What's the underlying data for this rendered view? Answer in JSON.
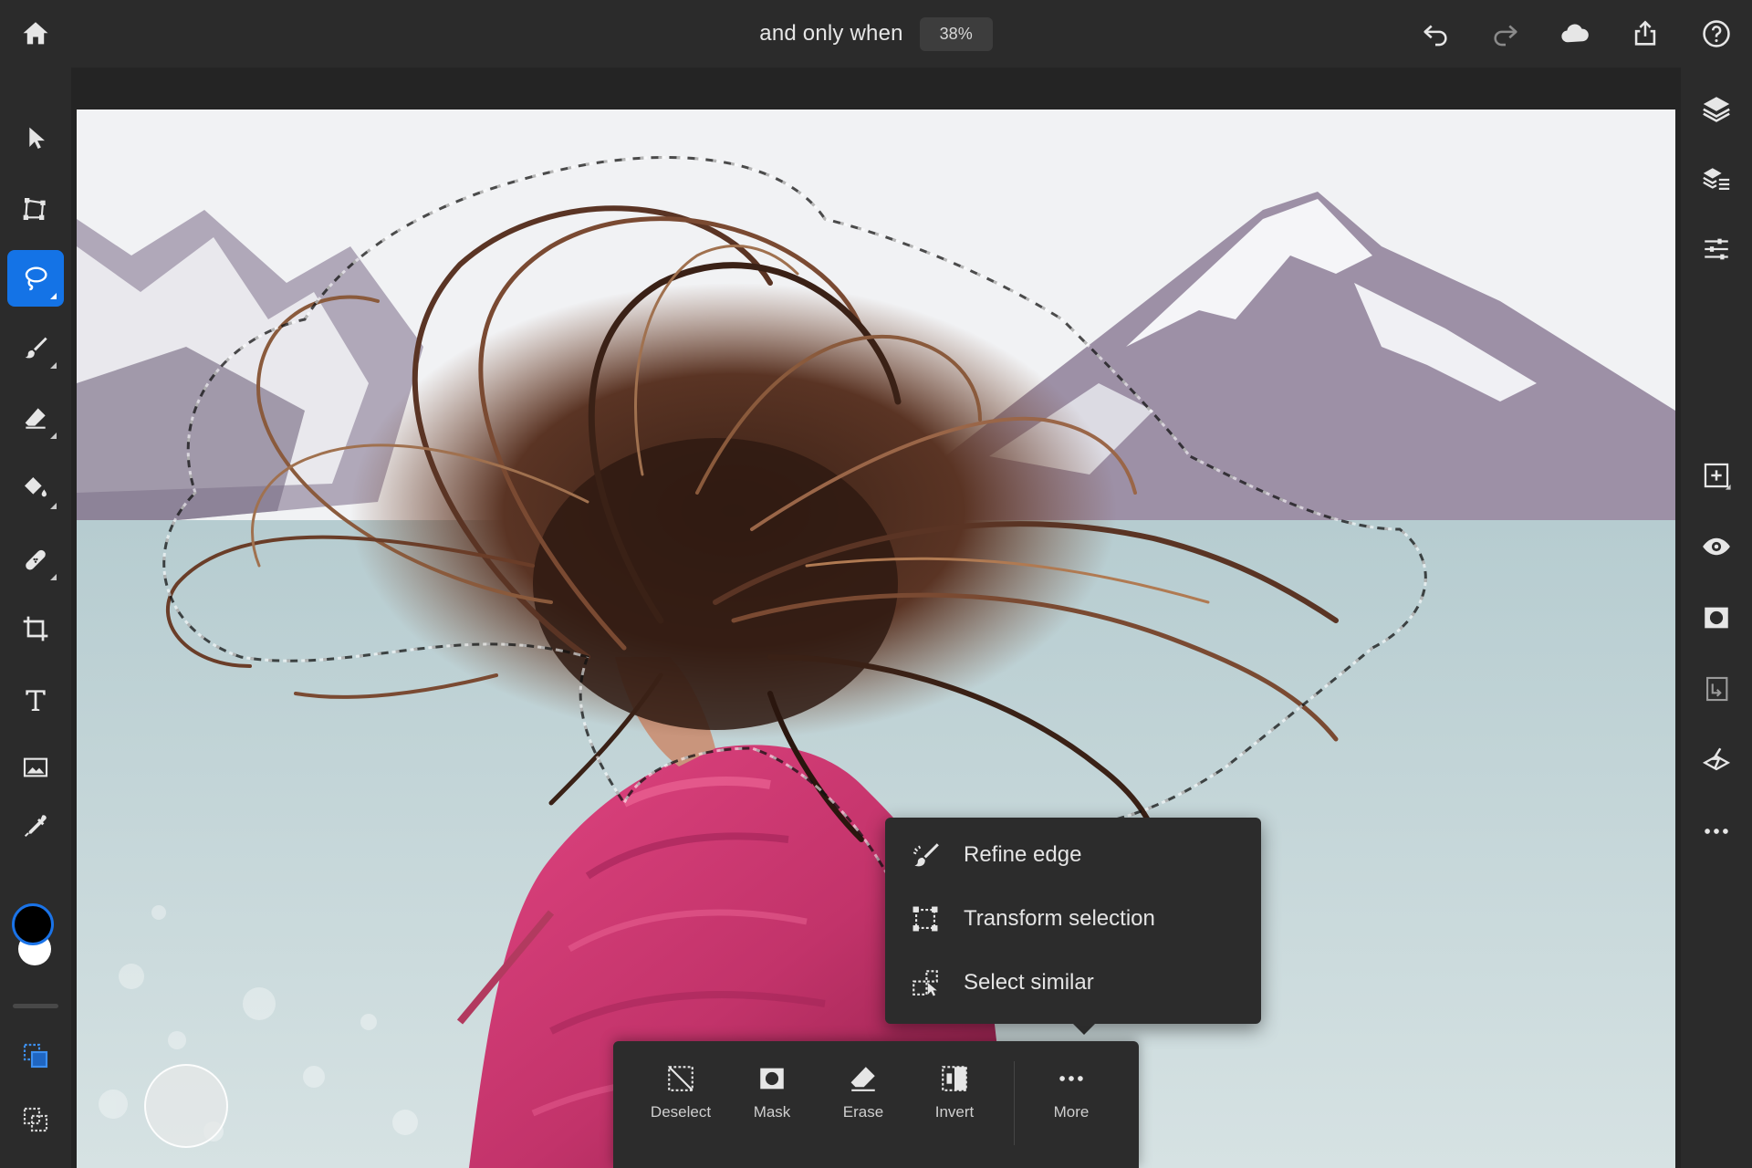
{
  "topbar": {
    "document_name": "and only when",
    "zoom": "38%",
    "icons": [
      "home-icon",
      "undo-icon",
      "redo-icon",
      "cloud-icon",
      "share-icon",
      "help-icon"
    ]
  },
  "left_toolbar": {
    "tools": [
      "move-tool",
      "transform-tool",
      "lasso-select-tool",
      "brush-tool",
      "eraser-tool",
      "fill-tool",
      "healing-tool",
      "crop-tool",
      "type-tool",
      "place-image-tool",
      "eyedropper-tool"
    ],
    "active_tool": "lasso-select-tool",
    "foreground_color": "#000000",
    "background_color": "#ffffff",
    "selection_modes": [
      "add-to-selection",
      "subtract-selection",
      "intersect-selection"
    ]
  },
  "right_panel": {
    "icons": [
      "layers-icon",
      "layer-details-icon",
      "adjustments-icon",
      "add-layer-icon",
      "visibility-icon",
      "mask-icon",
      "clip-icon",
      "properties-icon",
      "more-icon"
    ]
  },
  "context_menu": {
    "items": [
      {
        "label": "Refine edge",
        "icon": "brush-refine-icon"
      },
      {
        "label": "Transform selection",
        "icon": "transform-selection-icon"
      },
      {
        "label": "Select similar",
        "icon": "select-similar-icon"
      }
    ]
  },
  "taskbar": {
    "items": [
      {
        "label": "Deselect",
        "icon": "deselect-icon"
      },
      {
        "label": "Mask",
        "icon": "mask-icon"
      },
      {
        "label": "Erase",
        "icon": "erase-icon"
      },
      {
        "label": "Invert",
        "icon": "invert-icon"
      },
      {
        "label": "More",
        "icon": "more-icon"
      }
    ]
  },
  "colors": {
    "accent": "#1473e6",
    "ui_dark": "#2b2b2b",
    "jacket": "#c2336a"
  }
}
